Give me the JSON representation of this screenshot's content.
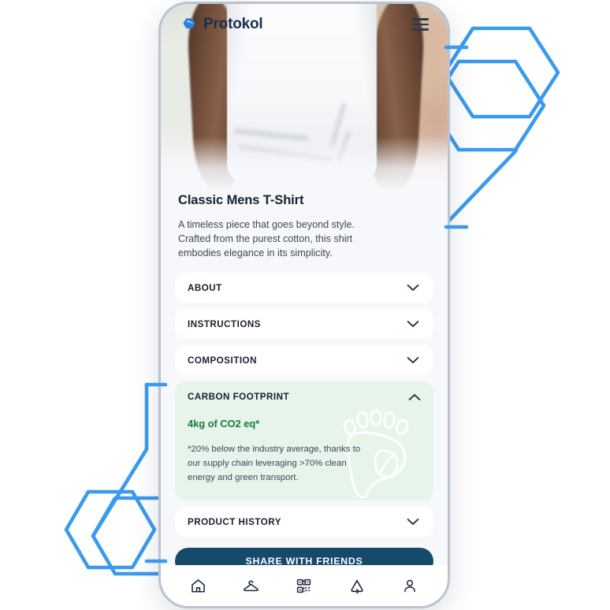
{
  "app": {
    "brand_name": "Protokol",
    "logo_icon": "hexagon-logo-icon",
    "menu_icon": "hamburger-menu-icon"
  },
  "hero": {
    "alt": "Person wearing a white classic t-shirt in a blurred kitchen"
  },
  "product": {
    "title": "Classic Mens T-Shirt",
    "description": "A timeless piece that goes beyond style. Crafted from the purest cotton, this shirt embodies elegance in its simplicity."
  },
  "accordions": [
    {
      "label": "ABOUT",
      "expanded": false,
      "icon": "chevron-down-icon"
    },
    {
      "label": "INSTRUCTIONS",
      "expanded": false,
      "icon": "chevron-down-icon"
    },
    {
      "label": "COMPOSITION",
      "expanded": false,
      "icon": "chevron-down-icon"
    }
  ],
  "carbon": {
    "label": "CARBON FOOTPRINT",
    "expanded": true,
    "icon": "chevron-up-icon",
    "value": "4kg of CO2 eq*",
    "note": "*20% below the industry average, thanks to our supply chain leveraging >70% clean energy and green transport.",
    "watermark_icon": "footprint-leaf-icon"
  },
  "product_history": {
    "label": "PRODUCT HISTORY",
    "expanded": false,
    "icon": "chevron-down-icon"
  },
  "share": {
    "label": "SHARE WITH FRIENDS"
  },
  "bottom_nav": [
    {
      "icon": "home-icon",
      "name": "home"
    },
    {
      "icon": "hanger-icon",
      "name": "wardrobe"
    },
    {
      "icon": "qr-code-icon",
      "name": "scan"
    },
    {
      "icon": "recycle-icon",
      "name": "recycle"
    },
    {
      "icon": "person-icon",
      "name": "profile"
    }
  ],
  "decor": {
    "hexagon_color": "#3b9aee"
  },
  "colors": {
    "brand_navy": "#17304d",
    "accent_blue": "#3b9aee",
    "green_panel": "#e6f4ea",
    "green_text": "#1f7a3d",
    "button_navy": "#164a6b",
    "screen_bg": "#f7f8fb",
    "frame": "#b9c3d1"
  }
}
